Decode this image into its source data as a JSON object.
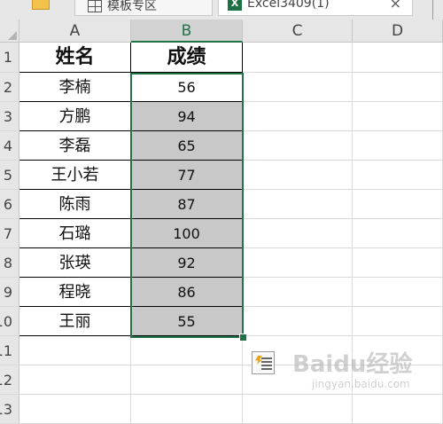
{
  "tabs": [
    {
      "label": "模板专区"
    },
    {
      "label": "Excel3409(1)",
      "icon_text": "X",
      "close": "×"
    }
  ],
  "columns": [
    "A",
    "B",
    "C",
    "D"
  ],
  "rows": [
    "1",
    "2",
    "3",
    "4",
    "5",
    "6",
    "7",
    "8",
    "9",
    "10",
    "11",
    "12",
    "13"
  ],
  "table": {
    "headers": {
      "name": "姓名",
      "score": "成绩"
    },
    "records": [
      {
        "name": "李楠",
        "score": "56"
      },
      {
        "name": "方鹏",
        "score": "94"
      },
      {
        "name": "李磊",
        "score": "65"
      },
      {
        "name": "王小若",
        "score": "77"
      },
      {
        "name": "陈雨",
        "score": "87"
      },
      {
        "name": "石璐",
        "score": "100"
      },
      {
        "name": "张瑛",
        "score": "92"
      },
      {
        "name": "程晓",
        "score": "86"
      },
      {
        "name": "王丽",
        "score": "55"
      }
    ]
  },
  "watermark": {
    "main": "Baidu经验",
    "sub": "jingyan.baidu.com"
  },
  "colors": {
    "accent": "#217346",
    "shaded_cell": "#c8c8c8"
  }
}
